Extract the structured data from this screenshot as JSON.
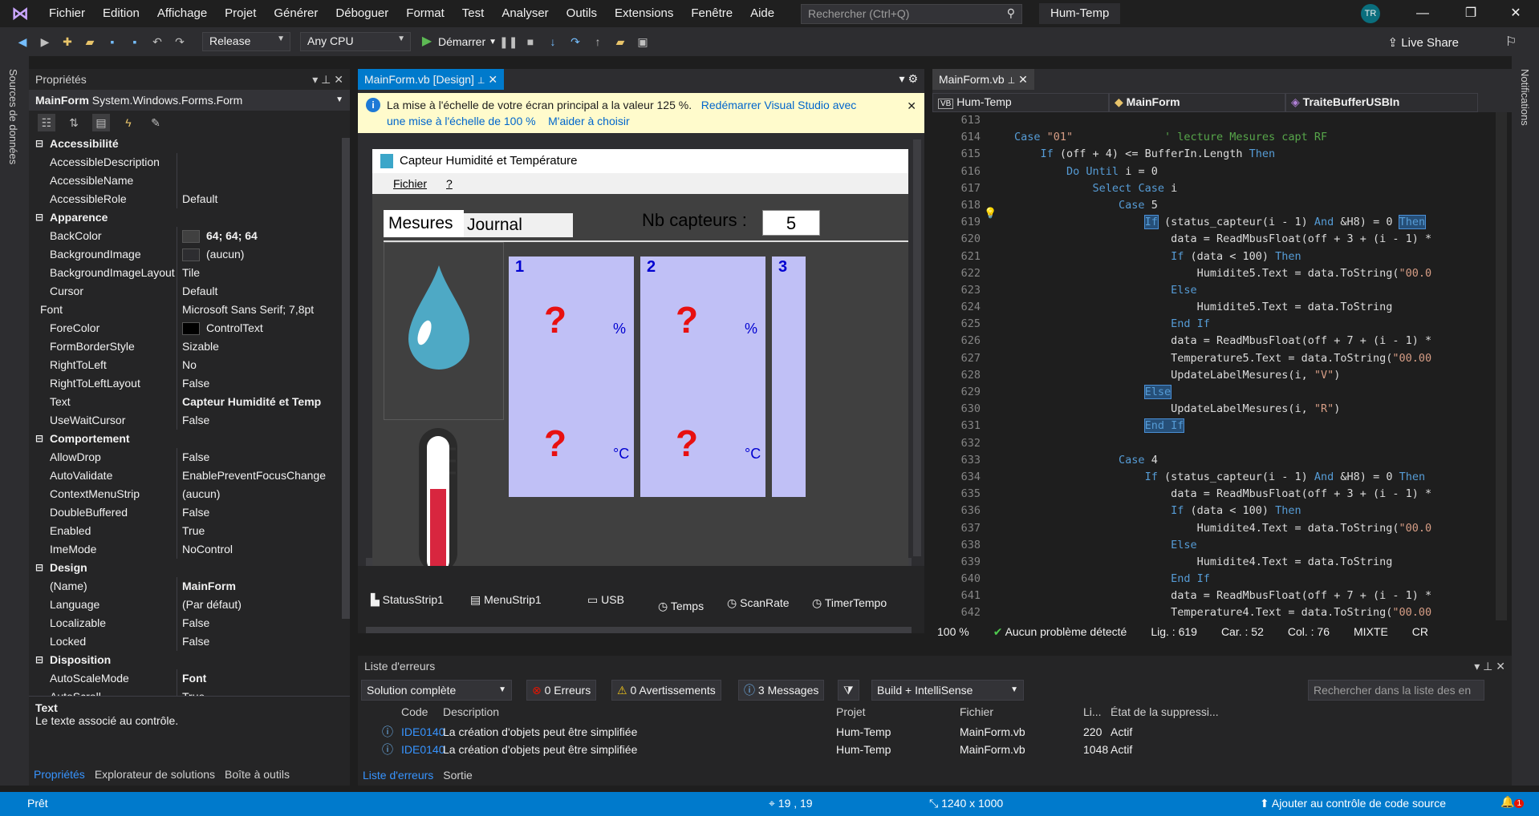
{
  "menu": [
    "Fichier",
    "Edition",
    "Affichage",
    "Projet",
    "Générer",
    "Déboguer",
    "Format",
    "Test",
    "Analyser",
    "Outils",
    "Extensions",
    "Fenêtre",
    "Aide"
  ],
  "search_placeholder": "Rechercher (Ctrl+Q)",
  "project_title": "Hum-Temp",
  "user_initials": "TR",
  "toolbar": {
    "config": "Release",
    "platform": "Any CPU",
    "start": "Démarrer",
    "live_share": "Live Share"
  },
  "side": {
    "left": "Sources de données",
    "right": "Notifications"
  },
  "props": {
    "title": "Propriétés",
    "object": "MainForm",
    "object_type": "System.Windows.Forms.Form",
    "categories": [
      {
        "name": "Accessibilité",
        "rows": [
          [
            "AccessibleDescription",
            ""
          ],
          [
            "AccessibleName",
            ""
          ],
          [
            "AccessibleRole",
            "Default"
          ]
        ]
      },
      {
        "name": "Apparence",
        "rows": [
          [
            "BackColor",
            "64; 64; 64"
          ],
          [
            "BackgroundImage",
            "(aucun)"
          ],
          [
            "BackgroundImageLayout",
            "Tile"
          ],
          [
            "Cursor",
            "Default"
          ],
          [
            "Font",
            "Microsoft Sans Serif; 7,8pt"
          ],
          [
            "ForeColor",
            "ControlText"
          ],
          [
            "FormBorderStyle",
            "Sizable"
          ],
          [
            "RightToLeft",
            "No"
          ],
          [
            "RightToLeftLayout",
            "False"
          ],
          [
            "Text",
            "Capteur Humidité et Temp"
          ],
          [
            "UseWaitCursor",
            "False"
          ]
        ]
      },
      {
        "name": "Comportement",
        "rows": [
          [
            "AllowDrop",
            "False"
          ],
          [
            "AutoValidate",
            "EnablePreventFocusChange"
          ],
          [
            "ContextMenuStrip",
            "(aucun)"
          ],
          [
            "DoubleBuffered",
            "False"
          ],
          [
            "Enabled",
            "True"
          ],
          [
            "ImeMode",
            "NoControl"
          ]
        ]
      },
      {
        "name": "Design",
        "rows": [
          [
            "(Name)",
            "MainForm"
          ],
          [
            "Language",
            "(Par défaut)"
          ],
          [
            "Localizable",
            "False"
          ],
          [
            "Locked",
            "False"
          ]
        ]
      },
      {
        "name": "Disposition",
        "rows": [
          [
            "AutoScaleMode",
            "Font"
          ],
          [
            "AutoScroll",
            "True"
          ]
        ]
      }
    ],
    "desc_title": "Text",
    "desc_text": "Le texte associé au contrôle.",
    "tabs": [
      "Propriétés",
      "Explorateur de solutions",
      "Boîte à outils"
    ]
  },
  "designer": {
    "tab": "MainForm.vb [Design]",
    "info_text": "La mise à l'échelle de votre écran principal a la valeur 125 %.",
    "info_link1a": "Redémarrer Visual Studio avec",
    "info_link1b": "une mise à l'échelle de 100 %",
    "info_link2": "M'aider à choisir",
    "form_title": "Capteur Humidité et Température",
    "form_menu": [
      "Fichier",
      "?"
    ],
    "tabs": [
      "Mesures",
      "Journal"
    ],
    "nb_label": "Nb capteurs :",
    "nb_value": "5",
    "sensors": [
      {
        "id": "1",
        "hum_unit": "%",
        "temp_unit": "°C",
        "value": "?"
      },
      {
        "id": "2",
        "hum_unit": "%",
        "temp_unit": "°C",
        "value": "?"
      },
      {
        "id": "3",
        "value": "?"
      }
    ],
    "tray": [
      "StatusStrip1",
      "MenuStrip1",
      "USB",
      "Temps",
      "ScanRate",
      "TimerTempo"
    ]
  },
  "code": {
    "tab": "MainForm.vb",
    "nav": [
      "Hum-Temp",
      "MainForm",
      "TraiteBufferUSBIn"
    ],
    "zoom": "100 %",
    "status": "Aucun problème détecté",
    "pos": {
      "line": "Lig. : 619",
      "car": "Car. : 52",
      "col": "Col. : 76",
      "mode": "MIXTE",
      "eol": "CR"
    }
  },
  "errors": {
    "title": "Liste d'erreurs",
    "scope": "Solution complète",
    "err": "0 Erreurs",
    "warn": "0 Avertissements",
    "msg": "3 Messages",
    "build": "Build + IntelliSense",
    "search": "Rechercher dans la liste des en",
    "cols": [
      "Code",
      "Description",
      "Projet",
      "Fichier",
      "Li...",
      "État de la suppressi..."
    ],
    "rows": [
      [
        "IDE0140",
        "La création d'objets peut être simplifiée",
        "Hum-Temp",
        "MainForm.vb",
        "220",
        "Actif"
      ],
      [
        "IDE0140",
        "La création d'objets peut être simplifiée",
        "Hum-Temp",
        "MainForm.vb",
        "1048",
        "Actif"
      ]
    ],
    "tabs": [
      "Liste d'erreurs",
      "Sortie"
    ]
  },
  "status": {
    "ready": "Prêt",
    "pos": "19 , 19",
    "size": "1240 x 1000",
    "source": "Ajouter au contrôle de code source",
    "notif": "1"
  }
}
